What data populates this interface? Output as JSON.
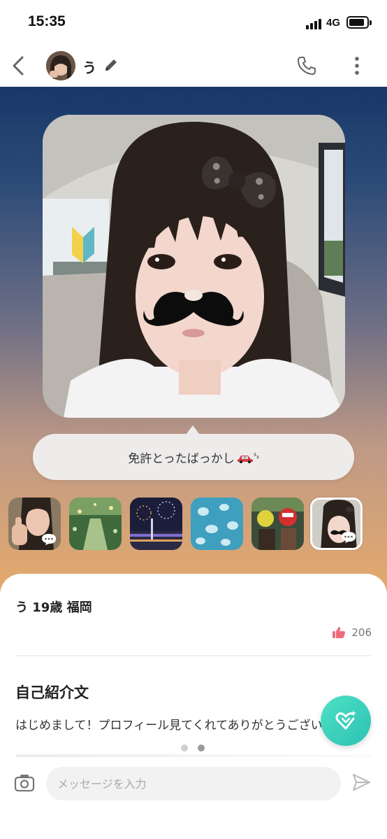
{
  "status_bar": {
    "time": "15:35",
    "network": "4G"
  },
  "header": {
    "name": "う",
    "back_icon": "chevron-left-icon",
    "edit_icon": "pencil-icon",
    "call_icon": "phone-icon",
    "more_icon": "more-vertical-icon"
  },
  "hero": {
    "caption_text": "免許とったばっかし",
    "caption_emoji": "car-icon",
    "caption_suffix": "³₃",
    "thumbnails": [
      {
        "name": "thumb-thumbsup",
        "has_chat_badge": true
      },
      {
        "name": "thumb-garden-lights",
        "has_chat_badge": false
      },
      {
        "name": "thumb-fireworks",
        "has_chat_badge": false
      },
      {
        "name": "thumb-jellyfish",
        "has_chat_badge": false
      },
      {
        "name": "thumb-characters",
        "has_chat_badge": false
      },
      {
        "name": "thumb-selfie-mustache",
        "has_chat_badge": true,
        "selected": true
      }
    ]
  },
  "profile": {
    "summary": "う 19歳 福岡",
    "likes_count": "206",
    "bio_title": "自己紹介文",
    "bio_text": "はじめまして！プロフィール見てくれてありがとうございます。"
  },
  "pager": {
    "total": 2,
    "active_index": 1
  },
  "input": {
    "placeholder": "メッセージを入力",
    "value": ""
  },
  "colors": {
    "accent_like": "#f06a7b",
    "fab": "#35cdb9",
    "hero_top": "#173868",
    "hero_bottom": "#e7ab6a"
  }
}
